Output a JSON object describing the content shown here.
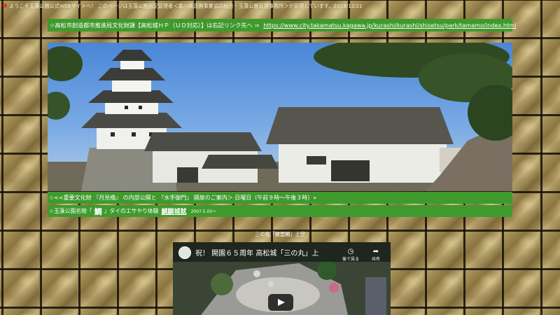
{
  "header": {
    "notice": "ようこそ玉藻公園公式WEBサイトへ！ このページは玉藻公園指定管理者＜香川県造園事業協同組合・玉藻公園管理事務所＞が管理しています。2019/12/21"
  },
  "link_bar": {
    "text": "☆高松市創造都市推進局文化財課【高松城ＨＰ（ＵＤ対応）】は右記リンク先へ ⇒",
    "url_text": "https://www.city.takamatsu.kagawa.jp/kurashi/kurashi/shisetsu/park/tamamo/index.html"
  },
  "photo": {
    "alt": "tamamo castle photo"
  },
  "notice_bars": {
    "opening": "☆<<重要文化財 『月見櫓』 の内部公開と 『水手御門』 開扉のご案内＞ 日曜日（午前９時～午後３時）»",
    "event_prefix": "☆玉藻公園名物「",
    "event_big": "鯛",
    "event_middle": "」タイのエサやり体験",
    "event_link": "鯛願城就",
    "event_date": "2007.5.05～"
  },
  "video": {
    "caption": "三の丸「披雲閣」上空",
    "title": "祝！ 開園６５周年 高松城「三の丸」上",
    "watch_later": "後で見る",
    "share": "共有"
  },
  "colors": {
    "green_bar": "#3f9a2d",
    "red_dot": "#e13a2a"
  }
}
